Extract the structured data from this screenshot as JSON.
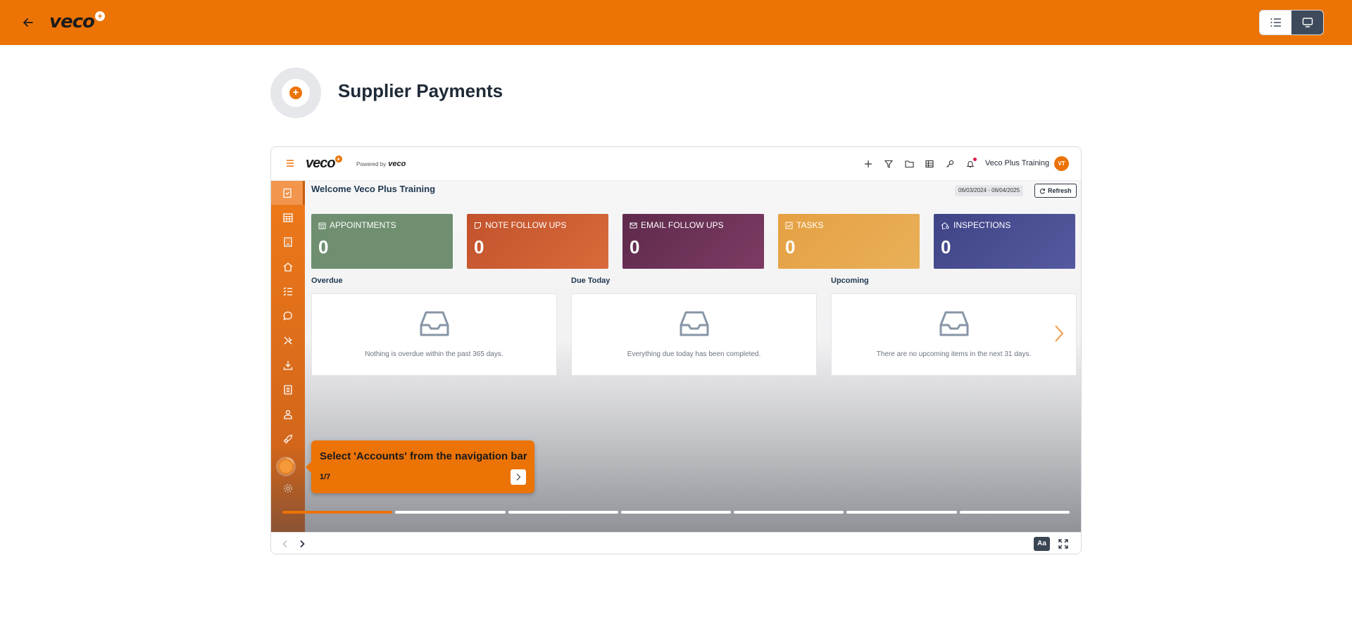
{
  "topbar": {
    "logo_text": "veco",
    "logo_plus": "+",
    "back_icon": "arrow-left-icon",
    "view_options": [
      "list-icon",
      "presentation-icon"
    ],
    "accent_color": "#ec7306"
  },
  "header": {
    "title": "Supplier Payments",
    "icon_symbol": "+"
  },
  "app": {
    "logo_text": "veco",
    "logo_plus": "+",
    "powered_by": "Powered by",
    "powered_logo": "veco",
    "user_name": "Veco Plus Training",
    "user_initials": "VT",
    "header_icons": [
      "plus-icon",
      "filter-icon",
      "folder-icon",
      "table-icon",
      "key-icon",
      "bell-icon"
    ],
    "sidebar_icons": [
      "clipboard-check-icon",
      "calendar-icon",
      "building-icon",
      "home-icon",
      "list-check-icon",
      "chat-icon",
      "tools-icon",
      "download-icon",
      "contact-card-icon",
      "person-icon",
      "rocket-icon",
      "accounts-icon",
      "gear-icon"
    ]
  },
  "dashboard": {
    "welcome": "Welcome Veco Plus Training",
    "date_range": "06/03/2024 - 06/04/2025",
    "refresh_label": "Refresh",
    "cards": [
      {
        "label": "APPOINTMENTS",
        "value": "0",
        "color": "#6f8f70",
        "icon": "calendar-icon"
      },
      {
        "label": "NOTE FOLLOW UPS",
        "value": "0",
        "color": "#c7542a",
        "icon": "note-icon"
      },
      {
        "label": "EMAIL FOLLOW UPS",
        "value": "0",
        "color": "#6b2d55",
        "icon": "mail-icon"
      },
      {
        "label": "TASKS",
        "value": "0",
        "color": "#e69e3d",
        "icon": "checkbox-icon"
      },
      {
        "label": "INSPECTIONS",
        "value": "0",
        "color": "#474a8c",
        "icon": "house-search-icon"
      }
    ],
    "sections": [
      {
        "title": "Overdue",
        "message": "Nothing is overdue within the past 365 days."
      },
      {
        "title": "Due Today",
        "message": "Everything due today has been completed."
      },
      {
        "title": "Upcoming",
        "message": "There are no upcoming items in the next 31 days."
      }
    ]
  },
  "tour": {
    "instruction": "Select 'Accounts' from the navigation bar",
    "step": "1/7",
    "progress_current": 1,
    "progress_total": 7
  },
  "controls": {
    "font_button": "Aa"
  }
}
